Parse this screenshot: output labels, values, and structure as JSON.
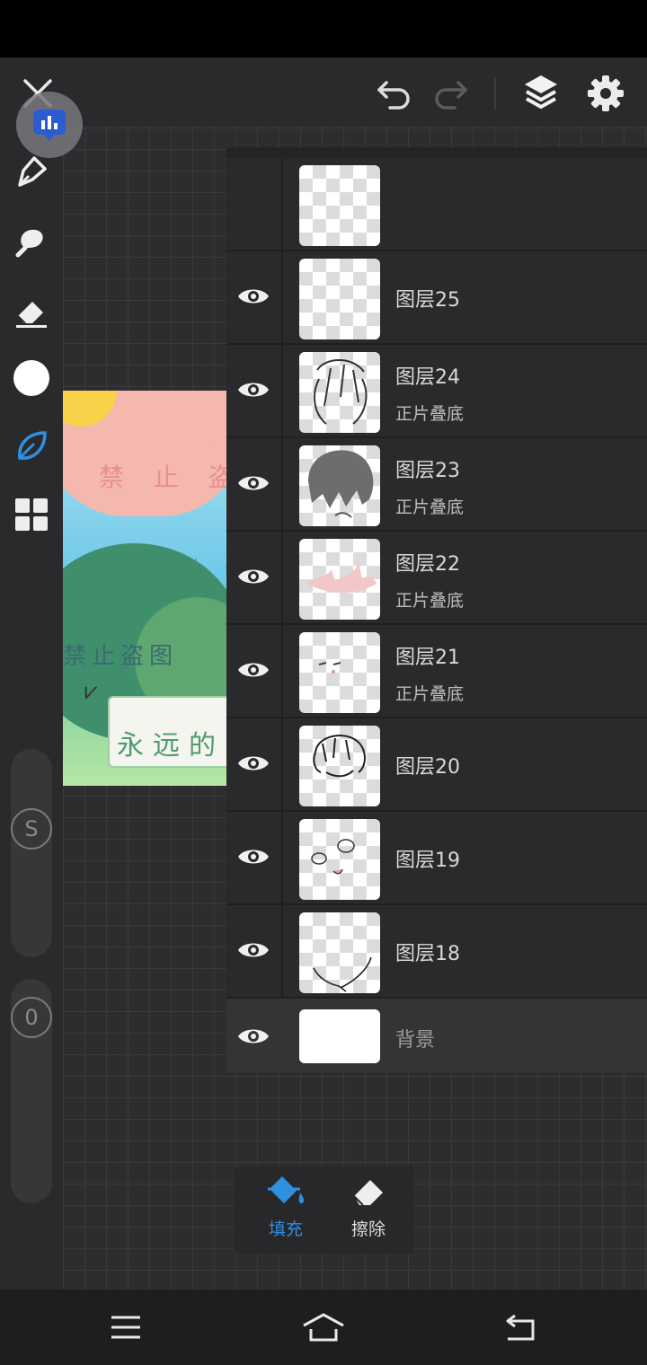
{
  "layers_panel": {
    "layers": [
      {
        "name": "图层25",
        "mode": ""
      },
      {
        "name": "图层24",
        "mode": "正片叠底"
      },
      {
        "name": "图层23",
        "mode": "正片叠底"
      },
      {
        "name": "图层22",
        "mode": "正片叠底"
      },
      {
        "name": "图层21",
        "mode": "正片叠底"
      },
      {
        "name": "图层20",
        "mode": ""
      },
      {
        "name": "图层19",
        "mode": ""
      },
      {
        "name": "图层18",
        "mode": ""
      }
    ],
    "background_layer": "背景"
  },
  "fill_popup": {
    "fill_label": "填充",
    "erase_label": "擦除",
    "active": "fill"
  },
  "sliders": {
    "size_label": "S",
    "opacity_label": "0"
  },
  "artwork": {
    "text1": "禁 止 盗",
    "text2": "禁 止 盗",
    "text3": "禁止盗图",
    "text4": "永远的"
  },
  "colors": {
    "accent": "#2f8fe0",
    "panel": "#242426",
    "row": "#2a2a2c",
    "current_color": "#ffffff"
  }
}
